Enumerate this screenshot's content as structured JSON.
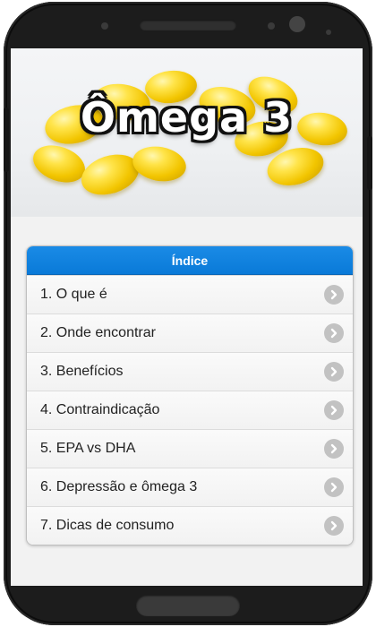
{
  "hero": {
    "title": "Ômega 3"
  },
  "index": {
    "header": "Índice",
    "items": [
      {
        "label": "1. O que é"
      },
      {
        "label": "2. Onde encontrar"
      },
      {
        "label": "3. Benefícios"
      },
      {
        "label": "4. Contraindicação"
      },
      {
        "label": "5. EPA vs DHA"
      },
      {
        "label": "6. Depressão e ômega 3"
      },
      {
        "label": "7. Dicas de consumo"
      }
    ]
  },
  "colors": {
    "accent": "#0a7ad8",
    "chevron": "#c2c2c2",
    "frame": "#1c1c1c"
  },
  "icons": {
    "item_chevron": "chevron-right-icon"
  }
}
